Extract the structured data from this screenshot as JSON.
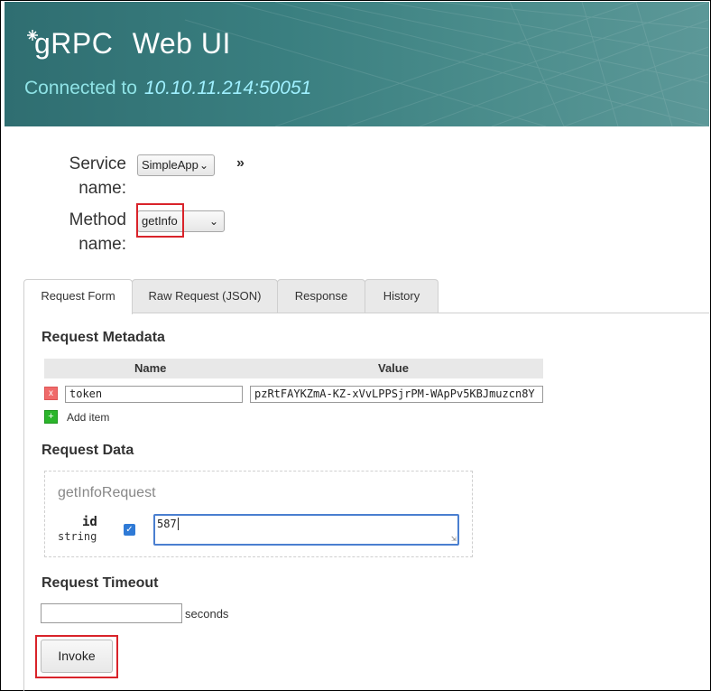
{
  "header": {
    "app_name_prefix": "gRPC",
    "app_name_suffix": "Web UI",
    "connected_label": "Connected to",
    "address": "10.10.11.214:50051"
  },
  "service": {
    "label": "Service name:",
    "label_line1": "Service",
    "label_line2": "name:",
    "selected": "SimpleApp"
  },
  "method": {
    "label_line1": "Method",
    "label_line2": "name:",
    "selected": "getInfo"
  },
  "more_glyph": "»",
  "tabs": [
    {
      "label": "Request Form",
      "active": true
    },
    {
      "label": "Raw Request (JSON)",
      "active": false
    },
    {
      "label": "Response",
      "active": false
    },
    {
      "label": "History",
      "active": false
    }
  ],
  "metadata": {
    "title": "Request Metadata",
    "col_name": "Name",
    "col_value": "Value",
    "rows": [
      {
        "name": "token",
        "value": "pzRtFAYKZmA-KZ-xVvLPPSjrPM-WApPv5KBJmuzcn8Y"
      }
    ],
    "delete_glyph": "x",
    "add_glyph": "+",
    "add_label": "Add item"
  },
  "request_data": {
    "title": "Request Data",
    "message": "getInfoRequest",
    "field_name": "id",
    "field_type": "string",
    "field_value": "587"
  },
  "timeout": {
    "title": "Request Timeout",
    "value": "",
    "unit": "seconds"
  },
  "invoke_label": "Invoke",
  "colors": {
    "header": "#3a7f80",
    "connected": "#8fe3e6",
    "highlight": "#d9232a",
    "add": "#2bb52b",
    "delete": "#f06a6a"
  }
}
